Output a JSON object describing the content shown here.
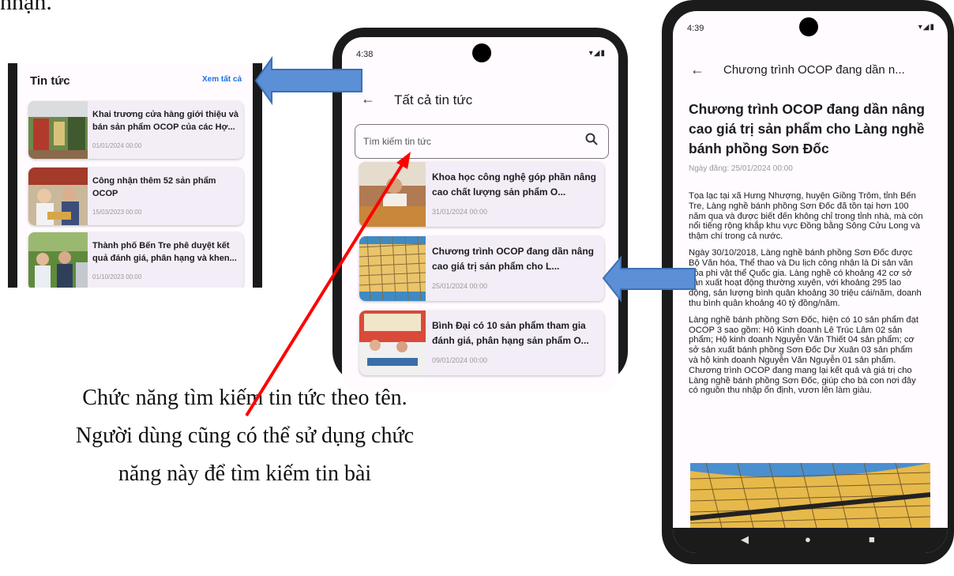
{
  "top_caption": "nhận.",
  "widget": {
    "title": "Tin tức",
    "see_all": "Xem tất cả",
    "items": [
      {
        "title": "Khai trương cửa hàng giới thiệu và bán sản phẩm OCOP của các Hợ...",
        "date": "01/01/2024 00:00"
      },
      {
        "title": "Công nhận thêm 52 sản phẩm OCOP",
        "date": "15/03/2023 00:00"
      },
      {
        "title": "Thành phố Bến Tre phê duyệt kết quả đánh giá, phân hạng và khen...",
        "date": "01/10/2023 00:00"
      }
    ]
  },
  "list_screen": {
    "status_time": "4:38",
    "title": "Tất cả tin tức",
    "search_placeholder": "Tìm kiếm tin tức",
    "items": [
      {
        "title": "Khoa học công nghệ góp phần nâng cao chất lượng sản phẩm O...",
        "date": "31/01/2024 00:00"
      },
      {
        "title": "Chương trình OCOP đang dần nâng cao giá trị sản phẩm cho L...",
        "date": "25/01/2024 00:00"
      },
      {
        "title": "Bình Đại có 10 sản phẩm tham gia đánh giá, phân hạng sản phẩm O...",
        "date": "09/01/2024 00:00"
      }
    ]
  },
  "detail_screen": {
    "status_time": "4:39",
    "appbar_title": "Chương trình OCOP đang dần n...",
    "headline": "Chương trình OCOP đang dần nâng cao giá trị sản phẩm cho Làng nghề bánh phồng Sơn Đốc",
    "posted": "Ngày đăng: 25/01/2024 00:00",
    "paragraphs": [
      "Tọa lạc tại xã Hưng Nhượng, huyện Giồng Trôm, tỉnh Bến Tre, Làng nghề bánh phồng Sơn Đốc đã tồn tại hơn 100 năm qua và được biết đến không chỉ trong tỉnh nhà, mà còn nổi tiếng rộng khắp khu vực Đồng bằng Sông Cửu Long và thậm chí trong cả nước.",
      "Ngày 30/10/2018, Làng nghề bánh phồng Sơn Đốc được Bộ Văn hóa, Thể thao và Du lịch công nhận là Di sản văn hóa phi vật thể Quốc gia. Làng nghề có khoảng 42 cơ sở sản xuất hoạt động thường xuyên, với khoảng 295 lao động, sản lượng bình quân khoảng 30 triệu cái/năm, doanh thu bình quân khoảng 40 tỷ đồng/năm.",
      "Làng nghề bánh phồng Sơn Đốc, hiện có 10 sản phẩm đạt OCOP 3 sao gồm: Hộ Kinh doanh Lê Trúc Lâm 02 sản phẩm; Hộ kinh doanh Nguyễn Văn Thiết 04 sản phẩm; cơ sở sản xuất bánh phồng Sơn Đốc Dư Xuân 03 sản phẩm và hộ kinh doanh Nguyễn Văn Nguyễn 01 sản phẩm. Chương trình OCOP đang mang lại kết quả và giá trị cho Làng nghề bánh phồng Sơn Đốc, giúp cho bà con nơi đây có nguồn thu nhập ổn định, vươn lên làm giàu."
    ]
  },
  "caption_lines": [
    "Chức năng tìm kiếm tin tức theo tên.",
    "Người dùng cũng có thể sử dụng chức",
    "năng này để tìm kiếm tin bài"
  ],
  "icons": {
    "back": "arrow-left-icon",
    "search": "search-icon",
    "status": "wifi-signal-battery-icon",
    "nav": [
      "nav-back-icon",
      "nav-home-icon",
      "nav-recents-icon"
    ]
  },
  "colors": {
    "screen_bg": "#fffbfe",
    "card_bg": "#f3edf7",
    "link": "#1a73e8",
    "callout_arrow": "#5b8fd6",
    "pointer_arrow": "#ff0000"
  }
}
